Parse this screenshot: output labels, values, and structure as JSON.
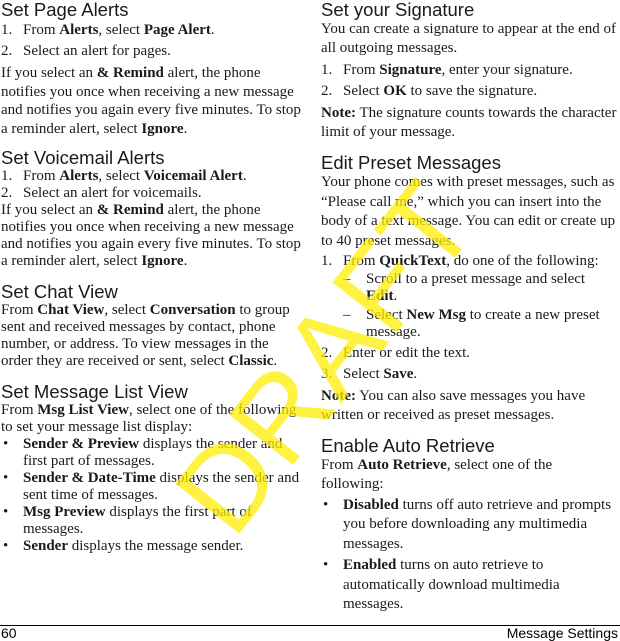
{
  "left_column": {
    "page_alerts": {
      "heading": "Set Page Alerts",
      "steps": [
        {
          "num": "1.",
          "parts": [
            "From ",
            "Alerts",
            ", select ",
            "Page Alert",
            "."
          ]
        },
        {
          "num": "2.",
          "text": "Select an alert for pages."
        }
      ],
      "para": {
        "pre": "If you select an ",
        "bold": "& Remind",
        "post": " alert, the phone notifies you once when receiving a new message and notifies you again every five minutes. To stop a reminder alert, select ",
        "bold2": "Ignore",
        "end": "."
      }
    },
    "voicemail_alerts": {
      "heading": "Set Voicemail Alerts",
      "steps": [
        {
          "num": "1.",
          "parts": [
            "From ",
            "Alerts",
            ", select ",
            "Voicemail Alert",
            "."
          ]
        },
        {
          "num": "2.",
          "text": "Select an alert for voicemails."
        }
      ],
      "para": {
        "pre": "If you select an ",
        "bold": "& Remind",
        "post": " alert, the phone notifies you once when receiving a new message and notifies you again every five minutes. To stop a reminder alert, select ",
        "bold2": "Ignore",
        "end": "."
      }
    },
    "chat_view": {
      "heading": "Set Chat View",
      "para": {
        "pre": "From ",
        "bold": "Chat View",
        "mid": ", select ",
        "bold2": "Conversation",
        "post": " to group sent and received messages by contact, phone number, or address. To view messages in the order they are received or sent, select ",
        "bold3": "Classic",
        "end": "."
      }
    },
    "message_list_view": {
      "heading": "Set Message List View",
      "intro": {
        "pre": "From ",
        "bold": "Msg List View",
        "post": ", select one of the following to set your message list display:"
      },
      "bullet": "•",
      "options": [
        {
          "bold": "Sender & Preview",
          "text": " displays the sender and first part of messages."
        },
        {
          "bold": "Sender & Date-Time",
          "text": " displays the sender and sent time of messages."
        },
        {
          "bold": "Msg Preview",
          "text": " displays the first part of messages."
        },
        {
          "bold": "Sender",
          "text": " displays the message sender."
        }
      ]
    }
  },
  "right_column": {
    "signature": {
      "heading": "Set your Signature",
      "intro": "You can create a signature to appear at the end of all outgoing messages.",
      "steps": [
        {
          "num": "1.",
          "parts": [
            "From ",
            "Signature",
            ", enter your signature."
          ]
        },
        {
          "num": "2.",
          "parts": [
            "Select ",
            "OK",
            " to save the signature."
          ]
        }
      ],
      "note": {
        "label": "Note:",
        "text": " The signature counts towards the character limit of your message."
      }
    },
    "preset_messages": {
      "heading": "Edit Preset Messages",
      "intro": "Your phone comes with preset messages, such as “Please call me,” which you can insert into the body of a text message. You can edit or create up to 40 preset messages.",
      "step1": {
        "num": "1.",
        "parts": [
          "From ",
          "QuickText",
          ", do one of the following:"
        ]
      },
      "dash": "–",
      "substeps": [
        {
          "pre": "Scroll to a preset message and select ",
          "bold": "Edit",
          "post": "."
        },
        {
          "pre": "Select ",
          "bold": "New Msg",
          "post": " to create a new preset message."
        }
      ],
      "step2": {
        "num": "2.",
        "text": "Enter or edit the text."
      },
      "step3": {
        "num": "3.",
        "parts": [
          "Select ",
          "Save",
          "."
        ]
      },
      "note": {
        "label": "Note:",
        "text": " You can also save messages you have written or received as preset messages."
      }
    },
    "auto_retrieve": {
      "heading": "Enable Auto Retrieve",
      "intro": {
        "pre": "From ",
        "bold": "Auto Retrieve",
        "post": ", select one of the following:"
      },
      "bullet": "•",
      "options": [
        {
          "bold": "Disabled",
          "text": " turns off auto retrieve and prompts you before downloading any multimedia messages."
        },
        {
          "bold": "Enabled",
          "text": " turns on auto retrieve to automatically download multimedia messages."
        }
      ]
    }
  },
  "footer": {
    "page_number": "60",
    "section_title": "Message Settings"
  },
  "watermark": {
    "text": "DRAFT",
    "color": "#FFEE00"
  }
}
